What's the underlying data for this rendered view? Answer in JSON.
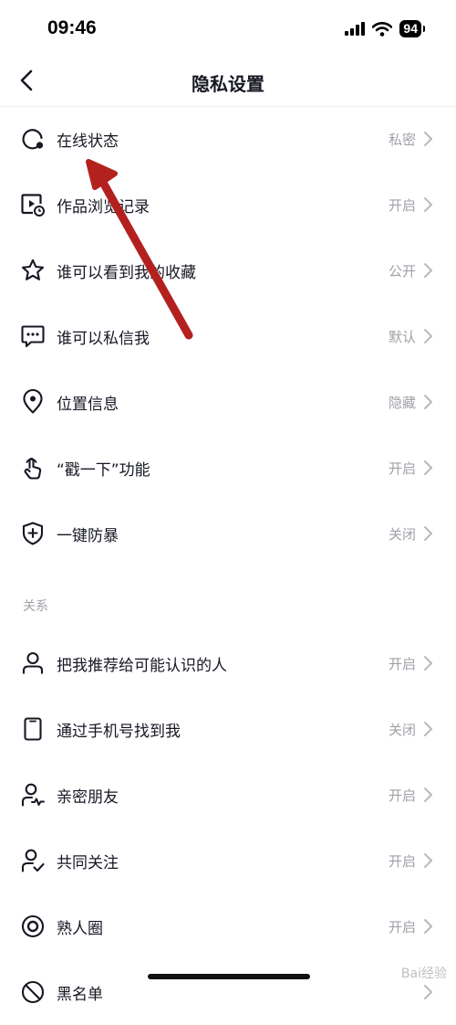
{
  "status": {
    "time": "09:46",
    "battery": "94"
  },
  "nav": {
    "title": "隐私设置"
  },
  "section_label": "关系",
  "rows": [
    {
      "label": "在线状态",
      "value": "私密"
    },
    {
      "label": "作品浏览记录",
      "value": "开启"
    },
    {
      "label": "谁可以看到我的收藏",
      "value": "公开"
    },
    {
      "label": "谁可以私信我",
      "value": "默认"
    },
    {
      "label": "位置信息",
      "value": "隐藏"
    },
    {
      "label": "“戳一下”功能",
      "value": "开启"
    },
    {
      "label": "一键防暴",
      "value": "关闭"
    },
    {
      "label": "把我推荐给可能认识的人",
      "value": "开启"
    },
    {
      "label": "通过手机号找到我",
      "value": "关闭"
    },
    {
      "label": "亲密朋友",
      "value": "开启"
    },
    {
      "label": "共同关注",
      "value": "开启"
    },
    {
      "label": "熟人圈",
      "value": "开启"
    },
    {
      "label": "黑名单",
      "value": ""
    }
  ],
  "watermark": "Bai经验",
  "colors": {
    "text": "#161823",
    "muted": "#a0a0a8",
    "annotation_arrow": "#b3211f"
  }
}
